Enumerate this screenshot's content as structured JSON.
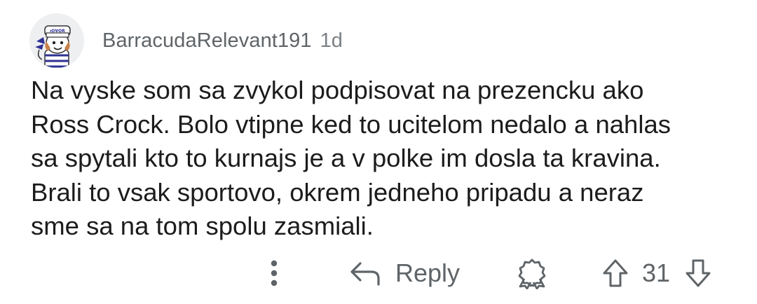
{
  "comment": {
    "author": "BarracudaRelevant191",
    "age": "1d",
    "body_lines": [
      "Na vyske som sa zvykol podpisovat na prezencku ako",
      "Ross Crock. Bolo vtipne ked to ucitelom nedalo a nahlas",
      "sa spytali kto to kurnajs je a v polke im dosla ta kravina.",
      "Brali to vsak sportovo, okrem jedneho pripadu a neraz",
      "sme sa na tom spolu zasmiali."
    ],
    "score": "31"
  },
  "actions": {
    "reply_label": "Reply"
  },
  "avatar": {
    "hat_text": "ᴉO∀OR",
    "hat_color": "#ffffff",
    "scarf_color": "#2e3192"
  },
  "colors": {
    "text": "#1c1c1c",
    "meta": "#5f6468",
    "avatar_bg": "#edeff1"
  },
  "icons": {
    "more": "more-vertical-icon",
    "reply": "reply-arrow-icon",
    "award": "award-icon",
    "upvote": "upvote-arrow-icon",
    "downvote": "downvote-arrow-icon"
  }
}
